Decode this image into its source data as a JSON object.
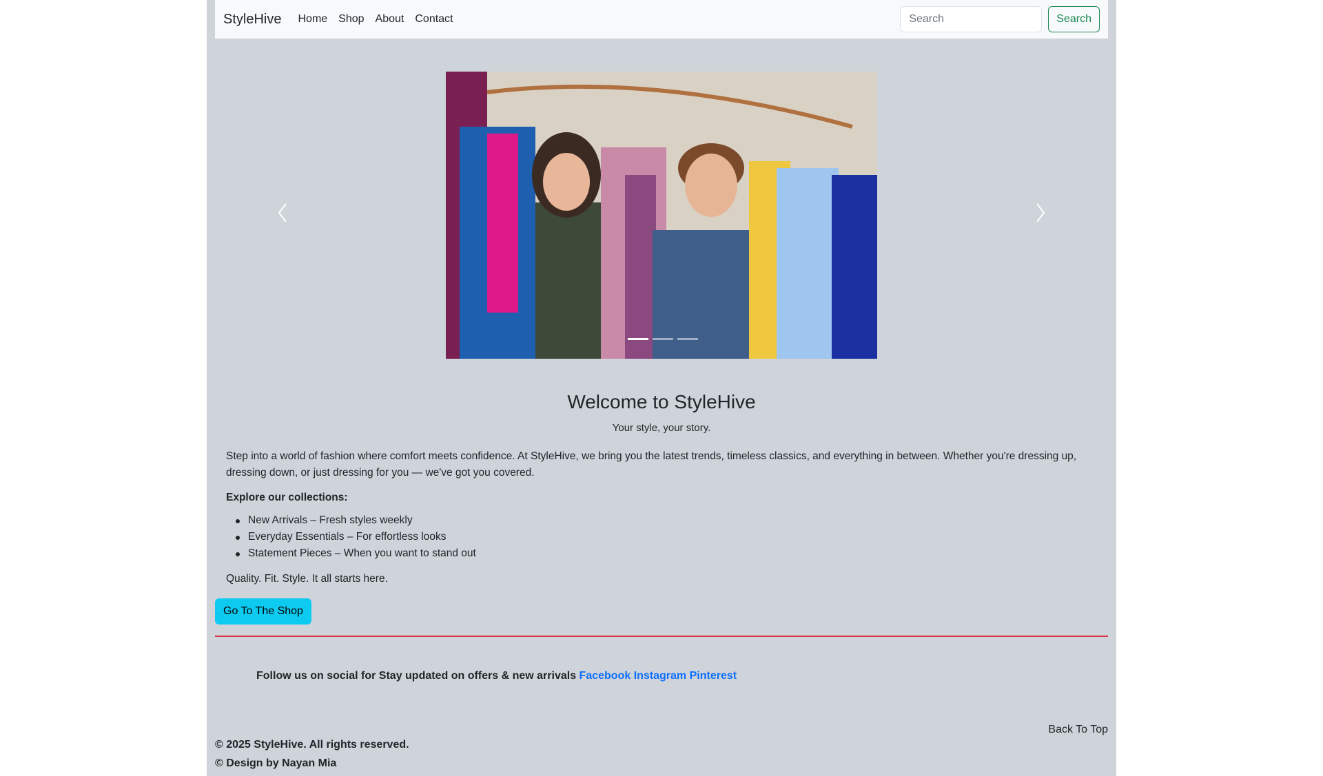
{
  "navbar": {
    "brand": "StyleHive",
    "links": [
      "Home",
      "Shop",
      "About",
      "Contact"
    ],
    "search_placeholder": "Search",
    "search_button": "Search"
  },
  "carousel": {
    "image": "shop-photo",
    "indicator_count": 3,
    "active_index": 0
  },
  "welcome": {
    "title": "Welcome to StyleHive",
    "tagline": "Your style, your story.",
    "intro": "Step into a world of fashion where comfort meets confidence. At StyleHive, we bring you the latest trends, timeless classics, and everything in between. Whether you're dressing up, dressing down, or just dressing for you — we've got you covered.",
    "explore_heading": "Explore our collections:",
    "collections": [
      "New Arrivals – Fresh styles weekly",
      "Everyday Essentials – For effortless looks",
      "Statement Pieces – When you want to stand out"
    ],
    "quality": "Quality. Fit. Style. It all starts here.",
    "shop_button": "Go To The Shop"
  },
  "social": {
    "text": "Follow us on social for Stay updated on offers & new arrivals",
    "links": [
      "Facebook",
      "Instagram",
      "Pinterest"
    ]
  },
  "footer": {
    "back_to_top": "Back To Top",
    "copyright": "© 2025 StyleHive. All rights reserved.",
    "designer": "© Design by Nayan Mia"
  },
  "colors": {
    "page_bg": "#cfd4da",
    "navbar_bg": "#f8f9fa",
    "search_btn": "#198754",
    "shop_btn": "#0dcaf0",
    "divider": "#dc3545",
    "link": "#0d6efd"
  }
}
